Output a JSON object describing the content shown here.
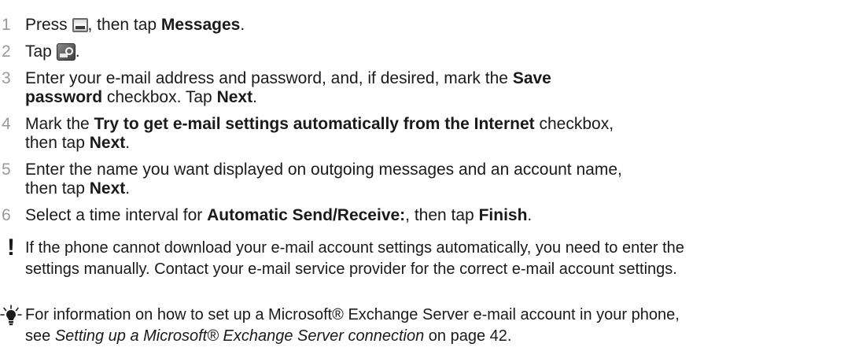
{
  "steps": [
    {
      "num": "1",
      "parts": [
        "Press ",
        "",
        ", then tap ",
        "Messages",
        "."
      ]
    },
    {
      "num": "2",
      "parts": [
        "Tap ",
        "",
        "."
      ]
    },
    {
      "num": "3",
      "parts": [
        "Enter your e-mail address and password, and, if desired, mark the ",
        "Save",
        "password",
        " checkbox. Tap ",
        "Next",
        "."
      ]
    },
    {
      "num": "4",
      "parts": [
        "Mark the ",
        "Try to get e-mail settings automatically from the Internet",
        " checkbox,",
        "then tap ",
        "Next",
        "."
      ]
    },
    {
      "num": "5",
      "parts": [
        "Enter the name you want displayed on outgoing messages and an account name,",
        "then tap ",
        "Next",
        "."
      ]
    },
    {
      "num": "6",
      "parts": [
        "Select a time interval for ",
        "Automatic Send/Receive:",
        ", then tap ",
        "Finish",
        "."
      ]
    }
  ],
  "icons": {
    "messages_key": "messages-key-icon",
    "new_account": "new-account-icon",
    "important": "exclamation-icon",
    "tip": "lightbulb-icon"
  },
  "note": {
    "line1": "If the phone cannot download your e-mail account settings automatically, you need to enter the",
    "line2": "settings manually. Contact your e-mail service provider for the correct e-mail account settings."
  },
  "tip": {
    "line1": "For information on how to set up a Microsoft® Exchange Server e-mail account in your phone,",
    "line2a": "see ",
    "line2_italic": "Setting up a Microsoft® Exchange Server connection",
    "line2b": " on page 42."
  },
  "colors": {
    "heading_red": "#e3000f",
    "step_number_gray": "#999999"
  }
}
